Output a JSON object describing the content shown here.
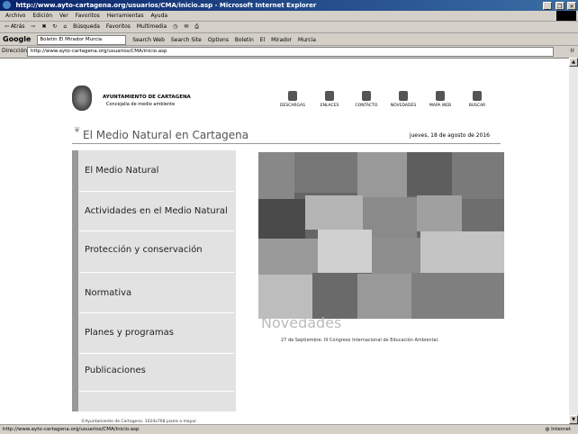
{
  "window": {
    "title": "http://www.ayto-cartagena.org/usuarios/CMA/inicio.asp - Microsoft Internet Explorer",
    "controls": [
      "_",
      "❐",
      "✕"
    ]
  },
  "menu": [
    "Archivo",
    "Edición",
    "Ver",
    "Favoritos",
    "Herramientas",
    "Ayuda"
  ],
  "toolbar": {
    "back": "⇦ Atrás",
    "forward": "⇨",
    "search": "Búsqueda",
    "favorites": "Favoritos",
    "multimedia": "Multimedia"
  },
  "googlebar": {
    "logo": "Google",
    "field_value": "Boletin El Mirador Murcia",
    "search_web": "Search Web",
    "search_site": "Search Site",
    "options": "Options",
    "term1": "Boletin",
    "term2": "El",
    "term3": "Mirador",
    "term4": "Murcia"
  },
  "addressbar": {
    "label": "Dirección",
    "url": "http://www.ayto-cartagena.org/usuarios/CMA/inicio.asp",
    "go": "Ir"
  },
  "page": {
    "org": "AYUNTAMIENTO DE CARTAGENA",
    "department": "Concejalía de medio ambiente",
    "topnav": [
      "DESCARGAS",
      "ENLACES",
      "CONTACTO",
      "NOVEDADES",
      "MAPA WEB",
      "BUSCAR"
    ],
    "site_title": "El Medio Natural en Cartagena",
    "date": "jueves, 18 de agosto de 2016",
    "left_menu": [
      "El Medio Natural",
      "Actividades en el Medio Natural",
      "Protección y conservación",
      "Normativa",
      "Planes y programas",
      "Publicaciones"
    ],
    "copyright": "©Ayuntamiento de Cartagena. 1024x768 pixels o mayor.",
    "news_heading": "Novedades",
    "news_item": "27 de Septiembre. III Congreso Internacional de Educación Ambiental."
  },
  "status": {
    "text": "http://www.ayto-cartagena.org/usuarios/CMA/inicio.asp",
    "zone": "Internet"
  }
}
